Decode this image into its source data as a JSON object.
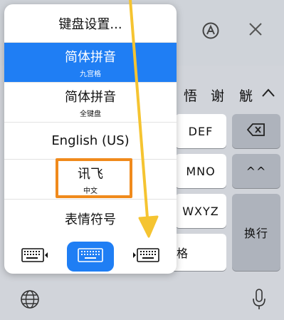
{
  "keyboard": {
    "toolbar_icons": [
      "handwriting-a-icon",
      "close-icon"
    ],
    "candidates": [
      "悟",
      "谢",
      "觥"
    ],
    "keys": {
      "def": "DEF",
      "mno": "MNO",
      "wxyz": "WXYZ",
      "face": "^^",
      "partial": "格",
      "return_label": "换行"
    },
    "bottom_icons": [
      "globe-icon",
      "microphone-icon"
    ]
  },
  "popup": {
    "settings_label": "键盘设置...",
    "items": [
      {
        "main": "简体拼音",
        "sub": "九宫格",
        "selected": true
      },
      {
        "main": "简体拼音",
        "sub": "全键盘",
        "selected": false
      },
      {
        "main": "English (US)",
        "sub": "",
        "selected": false
      },
      {
        "main": "讯飞",
        "sub": "中文",
        "selected": false,
        "highlighted": true
      },
      {
        "main": "表情符号",
        "sub": "",
        "selected": false
      }
    ],
    "layout_buttons": [
      "keyboard-left-icon",
      "keyboard-full-icon",
      "keyboard-right-icon"
    ],
    "active_layout_index": 1
  },
  "colors": {
    "selected": "#1f7ef4",
    "highlight": "#f08a1c",
    "arrow": "#f5c431"
  }
}
